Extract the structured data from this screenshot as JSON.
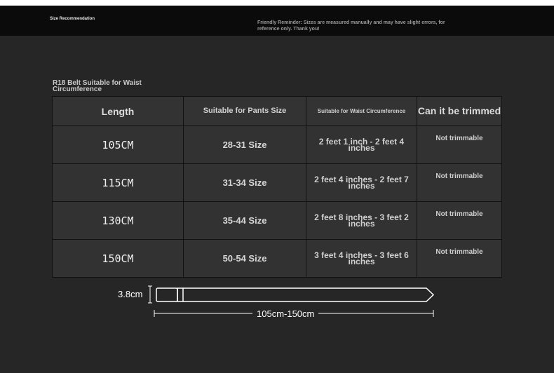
{
  "header": {
    "title": "Size Recommendation",
    "note": "Friendly Reminder: Sizes are measured manually and may have slight errors, for reference only. Thank you!"
  },
  "table": {
    "caption": "R18 Belt Suitable for Waist Circumference",
    "headers": {
      "length": "Length",
      "pants": "Suitable for Pants Size",
      "waist": "Suitable for Waist Circumference",
      "trim": "Can it be trimmed"
    },
    "rows": [
      {
        "length": "105CM",
        "pants": "28-31 Size",
        "waist": "2 feet 1 inch - 2 feet 4 inches",
        "trim": "Not trimmable"
      },
      {
        "length": "115CM",
        "pants": "31-34 Size",
        "waist": "2 feet 4 inches - 2 feet 7 inches",
        "trim": "Not trimmable"
      },
      {
        "length": "130CM",
        "pants": "35-44 Size",
        "waist": "2 feet 8 inches - 3 feet 2 inches",
        "trim": "Not trimmable"
      },
      {
        "length": "150CM",
        "pants": "50-54 Size",
        "waist": "3 feet 4 inches - 3 feet 6 inches",
        "trim": "Not trimmable"
      }
    ]
  },
  "belt_diagram": {
    "width_label": "3.8cm",
    "length_label": "105cm-150cm"
  },
  "colors": {
    "background": "#262626",
    "header_bar": "#0b0b0b",
    "table_cell": "#323232"
  }
}
